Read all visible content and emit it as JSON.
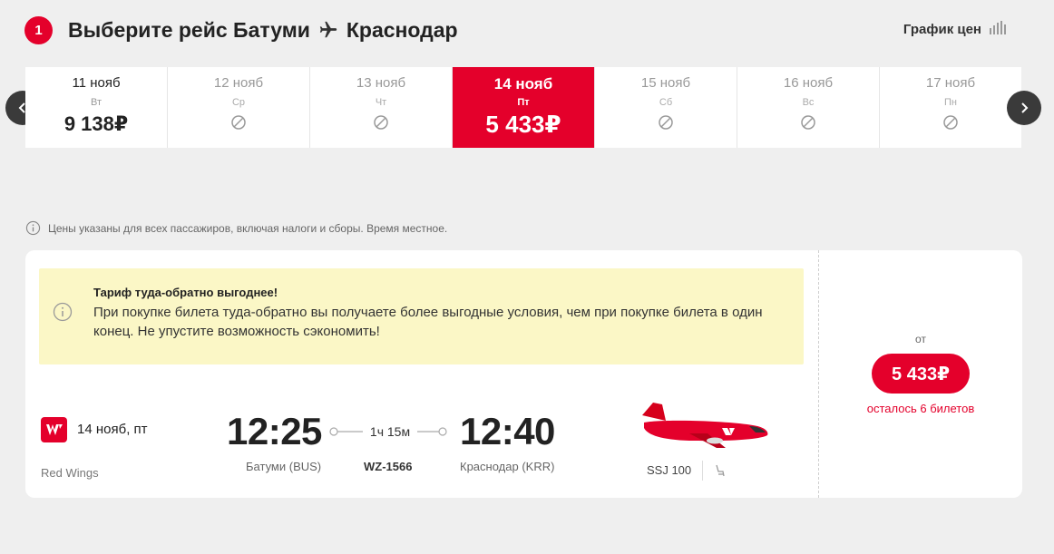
{
  "header": {
    "step": "1",
    "title_prefix": "Выберите рейс Батуми",
    "title_suffix": "Краснодар",
    "price_chart_label": "График цен"
  },
  "dates": [
    {
      "date": "11 нояб",
      "day": "Вт",
      "price": "9 138₽",
      "state": "available"
    },
    {
      "date": "12 нояб",
      "day": "Ср",
      "price": "",
      "state": "disabled"
    },
    {
      "date": "13 нояб",
      "day": "Чт",
      "price": "",
      "state": "disabled"
    },
    {
      "date": "14 нояб",
      "day": "Пт",
      "price": "5 433₽",
      "state": "selected"
    },
    {
      "date": "15 нояб",
      "day": "Сб",
      "price": "",
      "state": "disabled"
    },
    {
      "date": "16 нояб",
      "day": "Вс",
      "price": "",
      "state": "disabled"
    },
    {
      "date": "17 нояб",
      "day": "Пн",
      "price": "",
      "state": "disabled"
    }
  ],
  "info_note": "Цены указаны для всех пассажиров, включая налоги и сборы. Время местное.",
  "promo": {
    "title": "Тариф туда-обратно выгоднее!",
    "text": "При покупке билета туда-обратно вы получаете более выгодные условия, чем при покупке билета в один конец. Не упустите возможность сэкономить!"
  },
  "flight": {
    "date": "14 нояб, пт",
    "airline": "Red Wings",
    "departure_time": "12:25",
    "arrival_time": "12:40",
    "duration": "1ч 15м",
    "departure_airport": "Батуми (BUS)",
    "arrival_airport": "Краснодар (KRR)",
    "flight_number": "WZ-1566",
    "aircraft": "SSJ 100",
    "from_label": "от",
    "price": "5 433₽",
    "tickets_left": "осталось 6 билетов"
  },
  "colors": {
    "accent": "#e4002b",
    "promo_bg": "#fbf7c6",
    "page_bg": "#efefef"
  }
}
